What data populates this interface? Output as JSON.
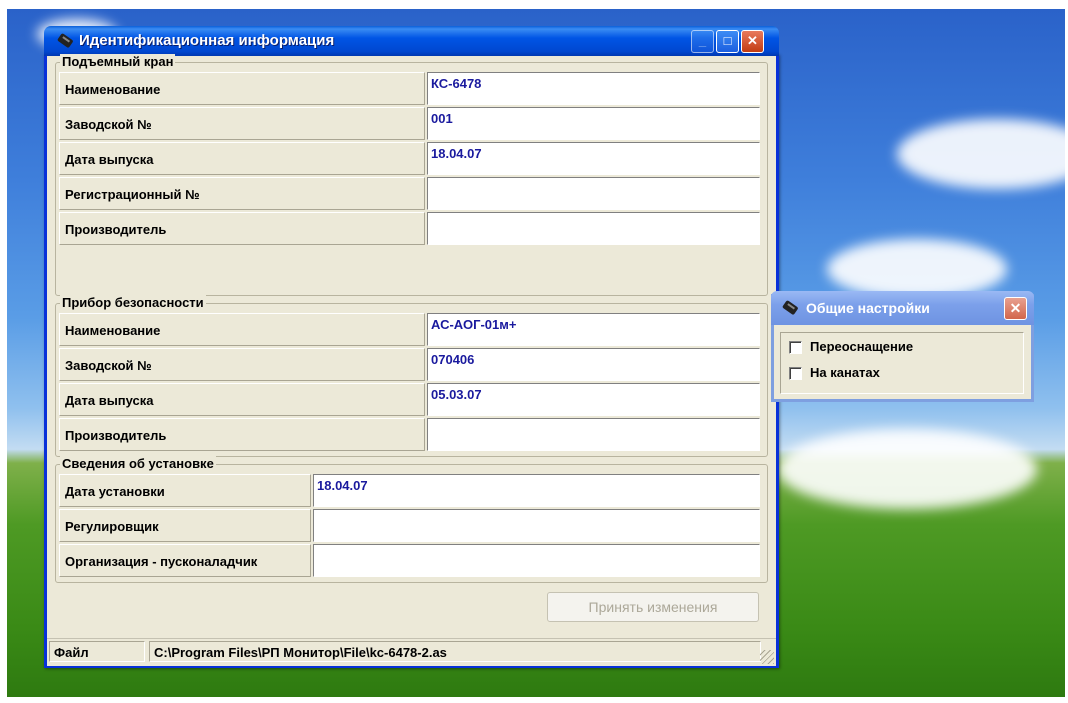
{
  "main_window": {
    "title": "Идентификационная информация",
    "min_label": "_",
    "max_label": "□",
    "close_label": "✕",
    "group_crane": {
      "legend": "Подъемный кран",
      "rows": [
        {
          "label": "Наименование",
          "value": "КС-6478"
        },
        {
          "label": "Заводской №",
          "value": "001"
        },
        {
          "label": "Дата выпуска",
          "value": "18.04.07"
        },
        {
          "label": "Регистрационный №",
          "value": ""
        },
        {
          "label": "Производитель",
          "value": ""
        }
      ]
    },
    "group_safety": {
      "legend": "Прибор безопасности",
      "rows": [
        {
          "label": "Наименование",
          "value": "АС-АОГ-01м+"
        },
        {
          "label": "Заводской №",
          "value": "070406"
        },
        {
          "label": "Дата выпуска",
          "value": "05.03.07"
        },
        {
          "label": "Производитель",
          "value": ""
        }
      ]
    },
    "group_install": {
      "legend": "Сведения об установке",
      "rows": [
        {
          "label": "Дата установки",
          "value": "18.04.07"
        },
        {
          "label": "Регулировщик",
          "value": ""
        },
        {
          "label": "Организация - пусконаладчик",
          "value": ""
        }
      ]
    },
    "apply_button": "Принять изменения",
    "status": {
      "label": "Файл",
      "path": "C:\\Program Files\\РП Монитор\\File\\kc-6478-2.as"
    }
  },
  "settings_window": {
    "title": "Общие настройки",
    "close_label": "✕",
    "options": [
      {
        "label": "Переоснащение",
        "checked": false
      },
      {
        "label": "На канатах",
        "checked": false
      }
    ]
  }
}
